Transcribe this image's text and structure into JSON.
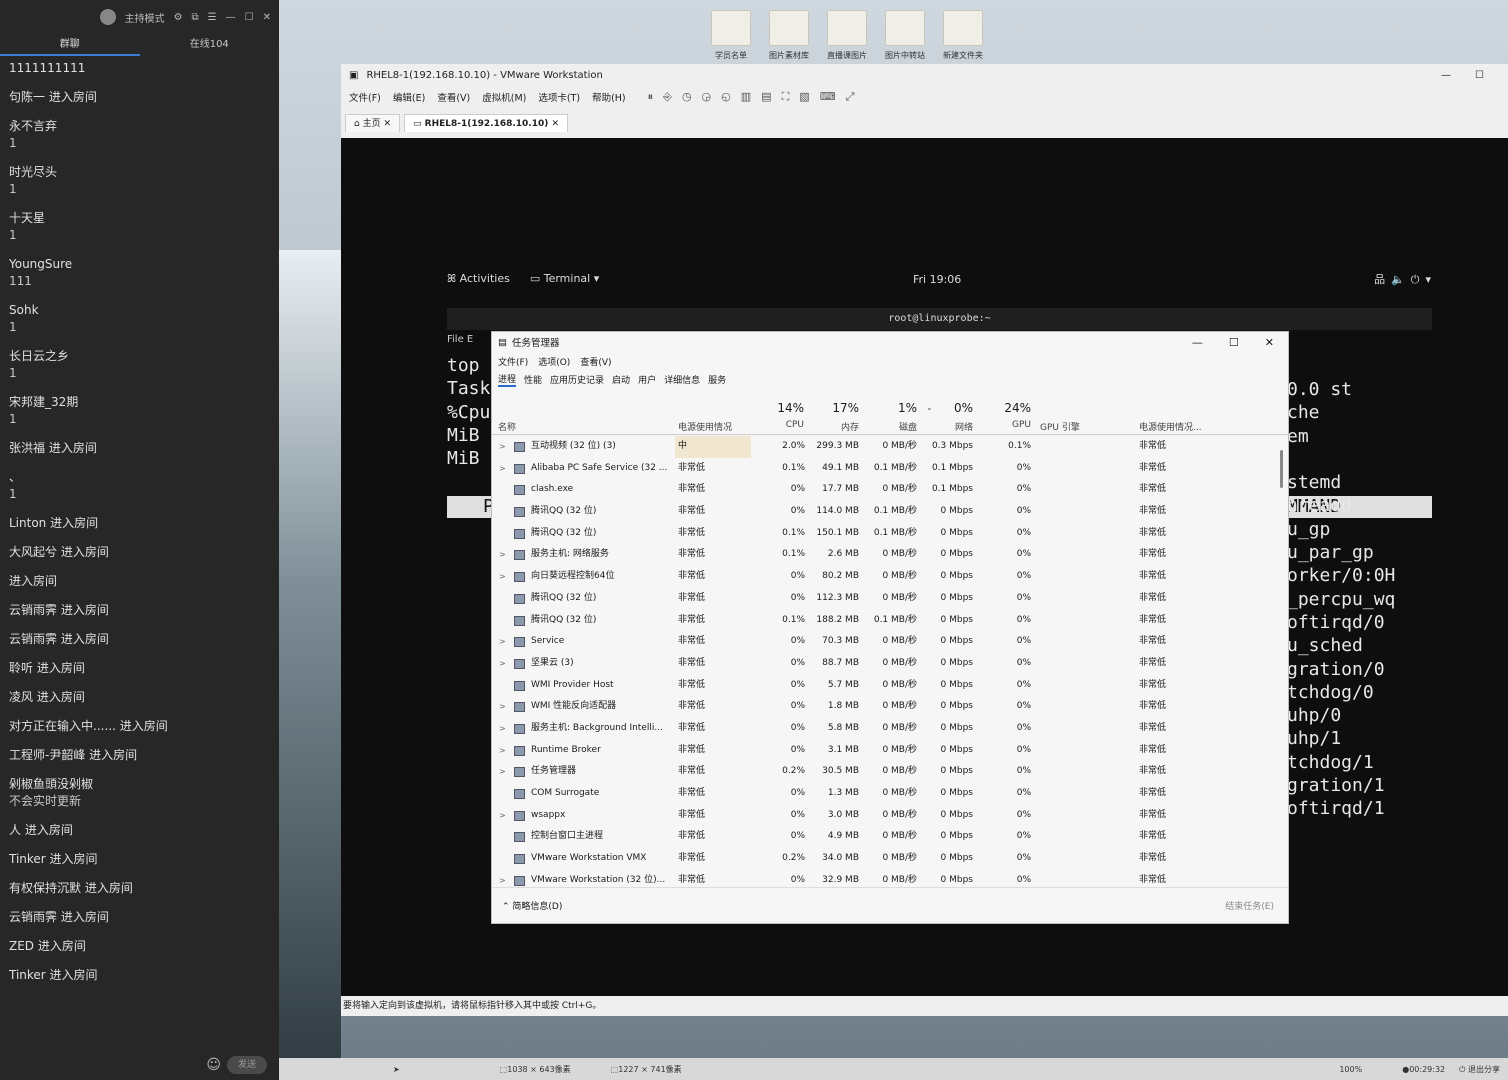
{
  "chat": {
    "header_mode": "主持模式",
    "tab_chat": "群聊",
    "tab_online": "在线104",
    "messages": [
      {
        "name": "1111111111",
        "text": ""
      },
      {
        "name": "句陈一 进入房间",
        "text": ""
      },
      {
        "name": "永不言弃",
        "text": "1"
      },
      {
        "name": "时光尽头",
        "text": "1"
      },
      {
        "name": "十天星",
        "text": "1"
      },
      {
        "name": "YoungSure",
        "text": "111"
      },
      {
        "name": "Sohk",
        "text": "1"
      },
      {
        "name": "长日云之乡",
        "text": "1"
      },
      {
        "name": "宋邦建_32期",
        "text": "1"
      },
      {
        "name": "张洪福 进入房间",
        "text": ""
      },
      {
        "name": "、",
        "text": "1"
      },
      {
        "name": "Linton 进入房间",
        "text": ""
      },
      {
        "name": "大风起兮 进入房间",
        "text": ""
      },
      {
        "name": "进入房间",
        "text": ""
      },
      {
        "name": "云销雨霁 进入房间",
        "text": ""
      },
      {
        "name": "云销雨霁 进入房间",
        "text": ""
      },
      {
        "name": "聆听 进入房间",
        "text": ""
      },
      {
        "name": "凌风 进入房间",
        "text": ""
      },
      {
        "name": "对方正在输入中...... 进入房间",
        "text": ""
      },
      {
        "name": "工程师-尹韶峰 进入房间",
        "text": ""
      },
      {
        "name": "剁椒鱼頭没剁椒",
        "text": "不会实时更新"
      },
      {
        "name": "人 进入房间",
        "text": ""
      },
      {
        "name": "Tinker 进入房间",
        "text": ""
      },
      {
        "name": "有权保持沉默 进入房间",
        "text": ""
      },
      {
        "name": "云销雨霁 进入房间",
        "text": ""
      },
      {
        "name": "ZED 进入房间",
        "text": ""
      },
      {
        "name": "Tinker 进入房间",
        "text": ""
      }
    ],
    "send_label": "发送"
  },
  "desktop_icons": [
    "学员名单",
    "图片素材库",
    "直播课图片",
    "图片中转站",
    "新建文件夹"
  ],
  "vmware": {
    "title": "RHEL8-1(192.168.10.10) - VMware Workstation",
    "menu": [
      "文件(F)",
      "编辑(E)",
      "查看(V)",
      "虚拟机(M)",
      "选项卡(T)",
      "帮助(H)"
    ],
    "tab_home": "主页",
    "tab_vm": "RHEL8-1(192.168.10.10)",
    "status": "要将输入定向到该虚拟机，请将鼠标指针移入其中或按 Ctrl+G。"
  },
  "gnome": {
    "activities": "Activities",
    "terminal": "Terminal ▾",
    "clock": "Fri 19:06"
  },
  "terminal": {
    "title": "root@linuxprobe:~",
    "menu": "File  E",
    "left_lines": [
      "top",
      "Task",
      "%Cpu",
      "MiB",
      "MiB"
    ],
    "header_left": "P",
    "header_right": "MMAND",
    "right_lines": [
      "0.0 st",
      "che",
      "em",
      "",
      "stemd",
      "hreadd",
      "u_gp",
      "u_par_gp",
      "orker/0:0H",
      "_percpu_wq",
      "oftirqd/0",
      "u_sched",
      "gration/0",
      "tchdog/0",
      "uhp/0",
      "uhp/1",
      "tchdog/1",
      "gration/1",
      "oftirqd/1"
    ]
  },
  "taskmgr": {
    "title": "任务管理器",
    "menu": [
      "文件(F)",
      "选项(O)",
      "查看(V)"
    ],
    "tabs": [
      "进程",
      "性能",
      "应用历史记录",
      "启动",
      "用户",
      "详细信息",
      "服务"
    ],
    "summary": {
      "cpu": "14%",
      "mem": "17%",
      "disk": "1%",
      "net": "0%",
      "gpu": "24%"
    },
    "col_labels": {
      "name": "名称",
      "power": "电源使用情况",
      "cpu": "CPU",
      "mem": "内存",
      "disk": "磁盘",
      "net": "网络",
      "gpu": "GPU",
      "gpu_engine": "GPU 引擎",
      "power_trend": "电源使用情况..."
    },
    "rows": [
      {
        "exp": ">",
        "name": "互动视频 (32 位) (3)",
        "power": "中",
        "cpu": "2.0%",
        "mem": "299.3 MB",
        "disk": "0 MB/秒",
        "net": "0.3 Mbps",
        "gpu": "0.1%",
        "trend": "非常低"
      },
      {
        "exp": ">",
        "name": "Alibaba PC Safe Service (32 ...",
        "power": "非常低",
        "cpu": "0.1%",
        "mem": "49.1 MB",
        "disk": "0.1 MB/秒",
        "net": "0.1 Mbps",
        "gpu": "0%",
        "trend": "非常低"
      },
      {
        "exp": "",
        "name": "clash.exe",
        "power": "非常低",
        "cpu": "0%",
        "mem": "17.7 MB",
        "disk": "0 MB/秒",
        "net": "0.1 Mbps",
        "gpu": "0%",
        "trend": "非常低"
      },
      {
        "exp": "",
        "name": "腾讯QQ (32 位)",
        "power": "非常低",
        "cpu": "0%",
        "mem": "114.0 MB",
        "disk": "0.1 MB/秒",
        "net": "0 Mbps",
        "gpu": "0%",
        "trend": "非常低"
      },
      {
        "exp": "",
        "name": "腾讯QQ (32 位)",
        "power": "非常低",
        "cpu": "0.1%",
        "mem": "150.1 MB",
        "disk": "0.1 MB/秒",
        "net": "0 Mbps",
        "gpu": "0%",
        "trend": "非常低"
      },
      {
        "exp": ">",
        "name": "服务主机: 网络服务",
        "power": "非常低",
        "cpu": "0.1%",
        "mem": "2.6 MB",
        "disk": "0 MB/秒",
        "net": "0 Mbps",
        "gpu": "0%",
        "trend": "非常低"
      },
      {
        "exp": ">",
        "name": "向日葵远程控制64位",
        "power": "非常低",
        "cpu": "0%",
        "mem": "80.2 MB",
        "disk": "0 MB/秒",
        "net": "0 Mbps",
        "gpu": "0%",
        "trend": "非常低"
      },
      {
        "exp": "",
        "name": "腾讯QQ (32 位)",
        "power": "非常低",
        "cpu": "0%",
        "mem": "112.3 MB",
        "disk": "0 MB/秒",
        "net": "0 Mbps",
        "gpu": "0%",
        "trend": "非常低"
      },
      {
        "exp": "",
        "name": "腾讯QQ (32 位)",
        "power": "非常低",
        "cpu": "0.1%",
        "mem": "188.2 MB",
        "disk": "0.1 MB/秒",
        "net": "0 Mbps",
        "gpu": "0%",
        "trend": "非常低"
      },
      {
        "exp": ">",
        "name": "Service",
        "power": "非常低",
        "cpu": "0%",
        "mem": "70.3 MB",
        "disk": "0 MB/秒",
        "net": "0 Mbps",
        "gpu": "0%",
        "trend": "非常低"
      },
      {
        "exp": ">",
        "name": "坚果云 (3)",
        "power": "非常低",
        "cpu": "0%",
        "mem": "88.7 MB",
        "disk": "0 MB/秒",
        "net": "0 Mbps",
        "gpu": "0%",
        "trend": "非常低"
      },
      {
        "exp": "",
        "name": "WMI Provider Host",
        "power": "非常低",
        "cpu": "0%",
        "mem": "5.7 MB",
        "disk": "0 MB/秒",
        "net": "0 Mbps",
        "gpu": "0%",
        "trend": "非常低"
      },
      {
        "exp": ">",
        "name": "WMI 性能反向适配器",
        "power": "非常低",
        "cpu": "0%",
        "mem": "1.8 MB",
        "disk": "0 MB/秒",
        "net": "0 Mbps",
        "gpu": "0%",
        "trend": "非常低"
      },
      {
        "exp": ">",
        "name": "服务主机: Background Intelli...",
        "power": "非常低",
        "cpu": "0%",
        "mem": "5.8 MB",
        "disk": "0 MB/秒",
        "net": "0 Mbps",
        "gpu": "0%",
        "trend": "非常低"
      },
      {
        "exp": ">",
        "name": "Runtime Broker",
        "power": "非常低",
        "cpu": "0%",
        "mem": "3.1 MB",
        "disk": "0 MB/秒",
        "net": "0 Mbps",
        "gpu": "0%",
        "trend": "非常低"
      },
      {
        "exp": ">",
        "name": "任务管理器",
        "power": "非常低",
        "cpu": "0.2%",
        "mem": "30.5 MB",
        "disk": "0 MB/秒",
        "net": "0 Mbps",
        "gpu": "0%",
        "trend": "非常低"
      },
      {
        "exp": "",
        "name": "COM Surrogate",
        "power": "非常低",
        "cpu": "0%",
        "mem": "1.3 MB",
        "disk": "0 MB/秒",
        "net": "0 Mbps",
        "gpu": "0%",
        "trend": "非常低"
      },
      {
        "exp": ">",
        "name": "wsappx",
        "power": "非常低",
        "cpu": "0%",
        "mem": "3.0 MB",
        "disk": "0 MB/秒",
        "net": "0 Mbps",
        "gpu": "0%",
        "trend": "非常低"
      },
      {
        "exp": "",
        "name": "控制台窗口主进程",
        "power": "非常低",
        "cpu": "0%",
        "mem": "4.9 MB",
        "disk": "0 MB/秒",
        "net": "0 Mbps",
        "gpu": "0%",
        "trend": "非常低"
      },
      {
        "exp": "",
        "name": "VMware Workstation VMX",
        "power": "非常低",
        "cpu": "0.2%",
        "mem": "34.0 MB",
        "disk": "0 MB/秒",
        "net": "0 Mbps",
        "gpu": "0%",
        "trend": "非常低"
      },
      {
        "exp": ">",
        "name": "VMware Workstation (32 位)...",
        "power": "非常低",
        "cpu": "0%",
        "mem": "32.9 MB",
        "disk": "0 MB/秒",
        "net": "0 Mbps",
        "gpu": "0%",
        "trend": "非常低"
      }
    ],
    "less_details": "简略信息(D)",
    "end_task": "结束任务(E)"
  },
  "bottom": {
    "size1": "1038 × 643像素",
    "size2": "1227 × 741像素",
    "zoom": "100%",
    "timer": "00:29:32",
    "exit": "退出分享"
  }
}
